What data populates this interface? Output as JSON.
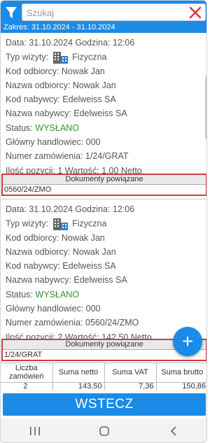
{
  "search": {
    "placeholder": "Szukaj",
    "value": ""
  },
  "range": {
    "label": "Zakres:",
    "from": "31.10.2024",
    "to": "31.10.2024",
    "text": "Zakres:  31.10.2024  -  31.10.2024"
  },
  "visits": [
    {
      "date_line": "Data:  31.10.2024  Godzina:  12:06",
      "type_label": "Typ wizyty:",
      "type_value": "Fizyczna",
      "recipient_code": "Kod odbiorcy:  Nowak Jan",
      "recipient_name": "Nazwa odbiorcy:  Nowak Jan",
      "buyer_code": "Kod nabywcy:  Edelweiss SA",
      "buyer_name": "Nazwa nabywcy:  Edelweiss SA",
      "status_label": "Status:",
      "status_value": "WYSŁANO",
      "main_trader": "Główny handlowiec:  000",
      "order_number": "Numer zamówienia:  1/24/GRAT",
      "items_line": "Ilość pozycji:  1  Wartość:  1,00 Netto",
      "related_docs_header": "Dokumenty powiązane",
      "related_docs": [
        "0560/24/ZMO"
      ]
    },
    {
      "date_line": "Data:  31.10.2024  Godzina:  12:06",
      "type_label": "Typ wizyty:",
      "type_value": "Fizyczna",
      "recipient_code": "Kod odbiorcy:  Nowak Jan",
      "recipient_name": "Nazwa odbiorcy:  Nowak Jan",
      "buyer_code": "Kod nabywcy:  Edelweiss SA",
      "buyer_name": "Nazwa nabywcy:  Edelweiss SA",
      "status_label": "Status:",
      "status_value": "WYSŁANO",
      "main_trader": "Główny handlowiec:  000",
      "order_number": "Numer zamówienia:  0560/24/ZMO",
      "items_line": "Ilość pozycji:  2  Wartość:  142,50 Netto",
      "related_docs_header": "Dokumenty powiązane",
      "related_docs": [
        "1/24/GRAT"
      ]
    }
  ],
  "fab": {
    "label": "+"
  },
  "summary": {
    "headers": [
      "Liczba zamówień",
      "Suma netto",
      "Suma VAT",
      "Suma brutto"
    ],
    "values": [
      "2",
      "143,50",
      "7,36",
      "150,86"
    ]
  },
  "back_button": {
    "label": "WSTECZ"
  },
  "colors": {
    "accent": "#1a8be6",
    "status_sent": "#2a9a2a",
    "highlight_border": "#d23a3a"
  },
  "icons": [
    "filter-icon",
    "close-icon",
    "building-icon",
    "plus-icon",
    "recent-apps-icon",
    "home-icon",
    "back-icon"
  ]
}
